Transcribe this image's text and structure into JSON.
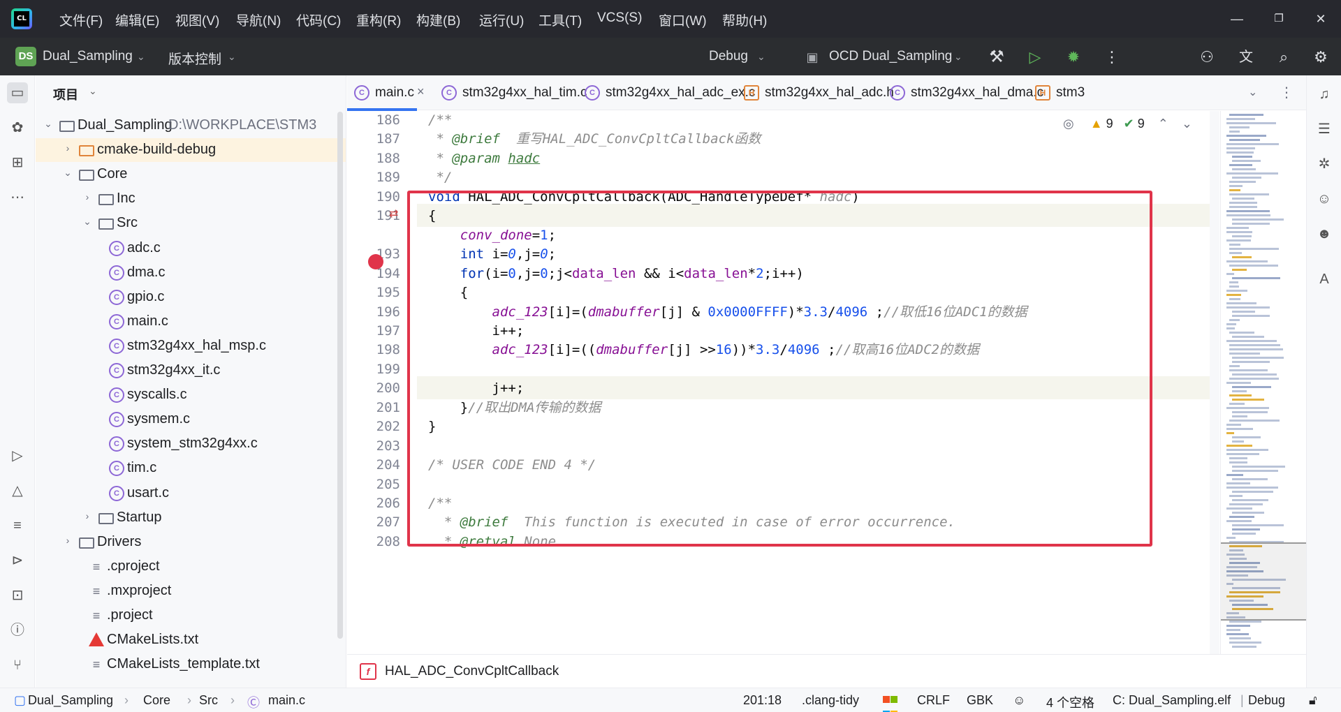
{
  "menu": {
    "items": [
      "文件(F)",
      "编辑(E)",
      "视图(V)",
      "导航(N)",
      "代码(C)",
      "重构(R)",
      "构建(B)",
      "运行(U)",
      "工具(T)",
      "VCS(S)",
      "窗口(W)",
      "帮助(H)"
    ]
  },
  "window_controls": {
    "minimize": "—",
    "restore": "❐",
    "close": "✕"
  },
  "toolbar": {
    "project_badge": "DS",
    "project_name": "Dual_Sampling",
    "vcs_label": "版本控制",
    "build_config": "Debug",
    "run_config": "OCD Dual_Sampling"
  },
  "project_panel": {
    "title": "项目",
    "tree": [
      {
        "label": "Dual_Sampling",
        "path": "D:\\WORKPLACE\\STM3",
        "type": "folder",
        "level": 0,
        "arrow": "⌄"
      },
      {
        "label": "cmake-build-debug",
        "type": "folder-orange",
        "level": 1,
        "arrow": "›",
        "selected": true
      },
      {
        "label": "Core",
        "type": "folder",
        "level": 1,
        "arrow": "⌄"
      },
      {
        "label": "Inc",
        "type": "folder",
        "level": 2,
        "arrow": "›"
      },
      {
        "label": "Src",
        "type": "folder",
        "level": 2,
        "arrow": "⌄"
      },
      {
        "label": "adc.c",
        "type": "c",
        "level": 3
      },
      {
        "label": "dma.c",
        "type": "c",
        "level": 3
      },
      {
        "label": "gpio.c",
        "type": "c",
        "level": 3
      },
      {
        "label": "main.c",
        "type": "c",
        "level": 3
      },
      {
        "label": "stm32g4xx_hal_msp.c",
        "type": "c",
        "level": 3
      },
      {
        "label": "stm32g4xx_it.c",
        "type": "c",
        "level": 3
      },
      {
        "label": "syscalls.c",
        "type": "c",
        "level": 3
      },
      {
        "label": "sysmem.c",
        "type": "c",
        "level": 3
      },
      {
        "label": "system_stm32g4xx.c",
        "type": "c",
        "level": 3
      },
      {
        "label": "tim.c",
        "type": "c",
        "level": 3
      },
      {
        "label": "usart.c",
        "type": "c",
        "level": 3
      },
      {
        "label": "Startup",
        "type": "folder",
        "level": 2,
        "arrow": "›"
      },
      {
        "label": "Drivers",
        "type": "folder",
        "level": 1,
        "arrow": "›"
      },
      {
        "label": ".cproject",
        "type": "text",
        "level": 1
      },
      {
        "label": ".mxproject",
        "type": "text",
        "level": 1
      },
      {
        "label": ".project",
        "type": "text",
        "level": 1
      },
      {
        "label": "CMakeLists.txt",
        "type": "cmake",
        "level": 1
      },
      {
        "label": "CMakeLists_template.txt",
        "type": "text",
        "level": 1
      }
    ]
  },
  "tabs": [
    {
      "label": "main.c",
      "icon": "c",
      "active": true,
      "close": "×"
    },
    {
      "label": "stm32g4xx_hal_tim.c",
      "icon": "c"
    },
    {
      "label": "stm32g4xx_hal_adc_ex.c",
      "icon": "c"
    },
    {
      "label": "stm32g4xx_hal_adc.h",
      "icon": "h"
    },
    {
      "label": "stm32g4xx_hal_dma.c",
      "icon": "c"
    },
    {
      "label": "stm3",
      "icon": "h"
    }
  ],
  "inspections": {
    "warnings": "9",
    "weak_warnings": "9"
  },
  "editor": {
    "lines": [
      {
        "n": "186",
        "html": "<span class='cm'>/**</span>"
      },
      {
        "n": "187",
        "html": "<span class='cm'> * </span><span class='tag'>@brief</span><span class='cm'>  重写HAL_ADC_ConvCpltCallback函数</span>"
      },
      {
        "n": "188",
        "html": "<span class='cm'> * </span><span class='tag'>@param</span><span class='cm'> </span><span class='tag' style='text-decoration:underline'>hadc</span>"
      },
      {
        "n": "189",
        "html": "<span class='cm'> */</span>"
      },
      {
        "n": "190",
        "html": "<span class='kw'>void</span> HAL_ADC_ConvCpltCallback(ADC_HandleTypeDef* <span class='cm'>hadc</span>)"
      },
      {
        "n": "191",
        "html": "{"
      },
      {
        "n": "",
        "html": "    <span class='mac'>conv_done</span>=<span class='num'>1</span>;"
      },
      {
        "n": "193",
        "html": "    <span class='kw'>int</span> i=<span class='num ital'>0</span>,j=<span class='num ital'>0</span>;"
      },
      {
        "n": "194",
        "html": "    <span class='kw'>for</span>(i=<span class='num'>0</span>,j=<span class='num'>0</span>;j&lt;<span class='var'>data_len</span> &amp;&amp; i&lt;<span class='var'>data_len</span>*<span class='num'>2</span>;i++)"
      },
      {
        "n": "195",
        "html": "    {"
      },
      {
        "n": "196",
        "html": "        <span class='mac'>adc_123</span>[i]=(<span class='mac'>dmabuffer</span>[j] &amp; <span class='num'>0x0000FFFF</span>)*<span class='num'>3.3</span>/<span class='num'>4096</span> ;<span class='cm'>//取低16位ADC1的数据</span>"
      },
      {
        "n": "197",
        "html": "        i++;"
      },
      {
        "n": "198",
        "html": "        <span class='mac'>adc_123</span>[i]=((<span class='mac'>dmabuffer</span>[j] &gt;&gt;<span class='num'>16</span>))*<span class='num'>3.3</span>/<span class='num'>4096</span> ;<span class='cm'>//取高16位ADC2的数据</span>"
      },
      {
        "n": "199",
        "html": ""
      },
      {
        "n": "200",
        "html": "        j++;"
      },
      {
        "n": "201",
        "html": "    }<span class='cm'>//取出DMA传输的数据</span>"
      },
      {
        "n": "202",
        "html": "}"
      },
      {
        "n": "203",
        "html": ""
      },
      {
        "n": "204",
        "html": "<span class='cm'>/* USER CODE END 4 */</span>"
      },
      {
        "n": "205",
        "html": ""
      },
      {
        "n": "206",
        "html": "<span class='cm'>/**</span>"
      },
      {
        "n": "207",
        "html": "<span class='cm'>  * </span><span class='tag'>@brief</span><span class='cm'>  This function is executed in case of error occurrence.</span>"
      },
      {
        "n": "208",
        "html": "<span class='cm'>  * </span><span class='tag'>@retval</span><span class='cm'> None</span>"
      }
    ]
  },
  "breadcrumb_function": "HAL_ADC_ConvCpltCallback",
  "statusbar": {
    "crumbs": [
      "Dual_Sampling",
      "Core",
      "Src",
      "main.c"
    ],
    "position": "201:18",
    "linter": ".clang-tidy",
    "line_ending": "CRLF",
    "encoding": "GBK",
    "indent": "4 个空格",
    "target": "C: Dual_Sampling.elf",
    "build": "Debug"
  },
  "colors": {
    "accent": "#3574f0",
    "highlight_box": "#e0344a",
    "breakpoint": "#e0344a"
  }
}
